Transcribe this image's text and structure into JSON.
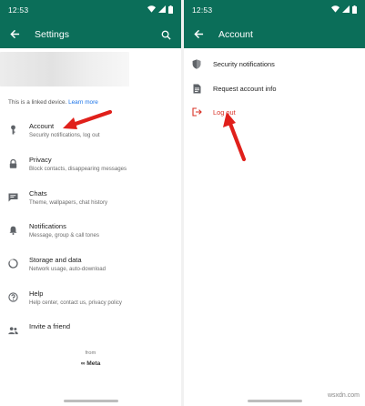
{
  "status": {
    "time_left": "12:53",
    "time_right": "12:53"
  },
  "settings": {
    "title": "Settings",
    "linked_text": "This is a linked device.",
    "learn_more": "Learn more",
    "items": [
      {
        "label": "Account",
        "sub": "Security notifications, log out",
        "icon": "key-icon"
      },
      {
        "label": "Privacy",
        "sub": "Block contacts, disappearing messages",
        "icon": "lock-icon"
      },
      {
        "label": "Chats",
        "sub": "Theme, wallpapers, chat history",
        "icon": "chat-icon"
      },
      {
        "label": "Notifications",
        "sub": "Message, group & call tones",
        "icon": "bell-icon"
      },
      {
        "label": "Storage and data",
        "sub": "Network usage, auto-download",
        "icon": "storage-icon"
      },
      {
        "label": "Help",
        "sub": "Help center, contact us, privacy policy",
        "icon": "help-icon"
      },
      {
        "label": "Invite a friend",
        "sub": "",
        "icon": "people-icon"
      }
    ],
    "from": "from",
    "meta": "Meta"
  },
  "account": {
    "title": "Account",
    "items": [
      {
        "label": "Security notifications",
        "icon": "shield-icon"
      },
      {
        "label": "Request account info",
        "icon": "document-icon"
      },
      {
        "label": "Log out",
        "icon": "logout-icon"
      }
    ]
  },
  "watermark": "wsxdn.com",
  "colors": {
    "header": "#0b6e59",
    "accent_red": "#e0201b",
    "logout_red": "#d93025",
    "link_blue": "#1a73e8"
  }
}
